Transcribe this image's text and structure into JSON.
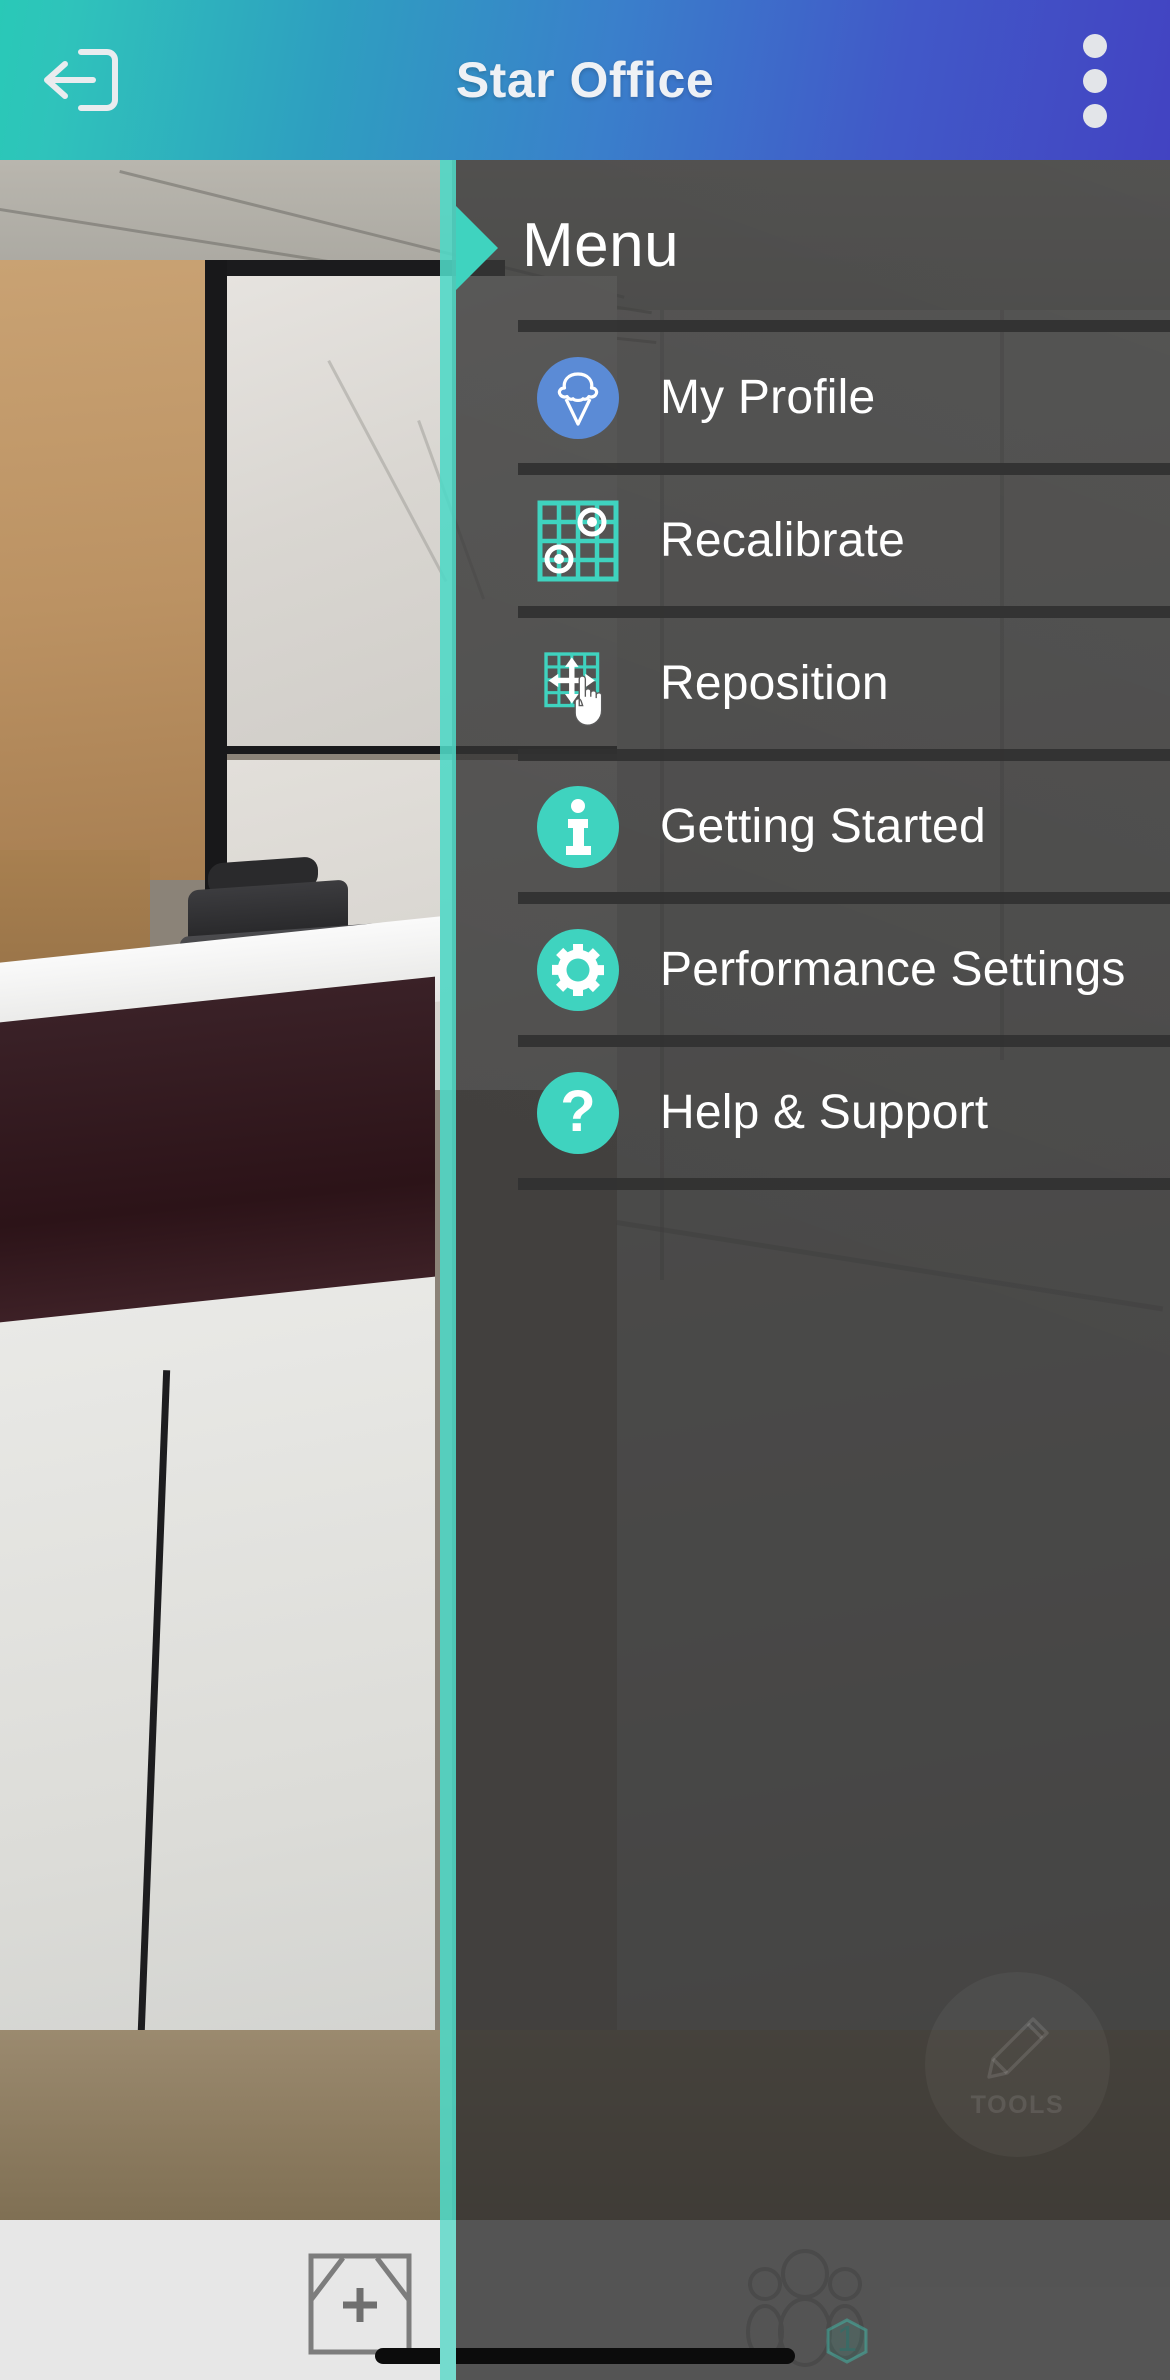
{
  "header": {
    "title": "Star Office",
    "exit_icon": "exit-arrow-icon",
    "overflow_icon": "three-dot-menu-icon",
    "gradient_start": "#29c9b7",
    "gradient_end": "#4243c2"
  },
  "drawer": {
    "title": "Menu",
    "accent_color": "#3fd3bf",
    "panel_color": "#303030",
    "items": [
      {
        "label": "My Profile",
        "icon": "ice-cream-avatar-icon",
        "icon_style": "circle-blue",
        "icon_color": "#5b8bd6"
      },
      {
        "label": "Recalibrate",
        "icon": "grid-target-icon",
        "icon_style": "grid",
        "icon_color": "#3fd3bf"
      },
      {
        "label": "Reposition",
        "icon": "grid-move-hand-icon",
        "icon_style": "grid-hand",
        "icon_color": "#3fd3bf"
      },
      {
        "label": "Getting Started",
        "icon": "info-circle-icon",
        "icon_style": "circle-teal",
        "icon_color": "#3fd3bf"
      },
      {
        "label": "Performance Settings",
        "icon": "gear-circle-icon",
        "icon_style": "circle-teal",
        "icon_color": "#3fd3bf"
      },
      {
        "label": "Help & Support",
        "icon": "question-circle-icon",
        "icon_style": "circle-teal",
        "icon_color": "#3fd3bf"
      }
    ]
  },
  "tools_fab": {
    "label": "TOOLS",
    "icon": "pencil-icon"
  },
  "bottom_bar": {
    "add_area_icon": "add-room-plus-icon",
    "people_icon": "people-group-icon",
    "people_badge": "1",
    "home_indicator": "home-indicator-bar"
  }
}
